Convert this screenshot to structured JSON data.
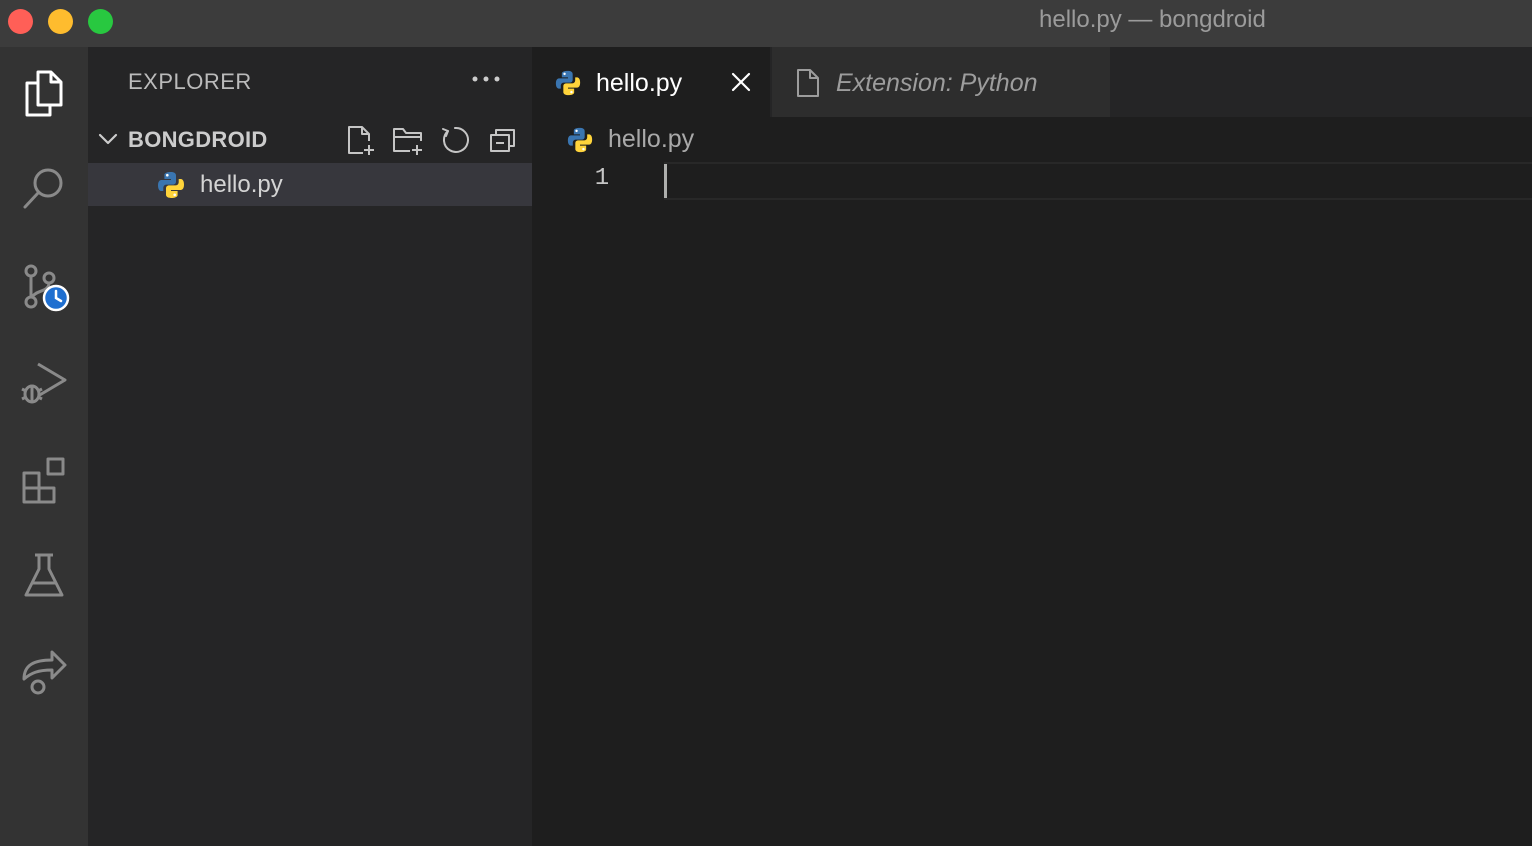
{
  "window": {
    "title": "hello.py — bongdroid",
    "controls": [
      "close",
      "minimize",
      "zoom"
    ]
  },
  "activity_bar": {
    "items": [
      {
        "icon": "files-icon",
        "active": true
      },
      {
        "icon": "search-icon",
        "active": false
      },
      {
        "icon": "source-control-icon",
        "active": false
      },
      {
        "icon": "run-debug-icon",
        "active": false
      },
      {
        "icon": "extensions-icon",
        "active": false
      },
      {
        "icon": "testing-icon",
        "active": false
      },
      {
        "icon": "remote-share-icon",
        "active": false
      }
    ]
  },
  "sidebar": {
    "header": "EXPLORER",
    "more_icon": "ellipsis-icon",
    "folder": {
      "name": "BONGDROID",
      "actions": [
        "new-file-icon",
        "new-folder-icon",
        "refresh-icon",
        "collapse-all-icon"
      ]
    },
    "files": [
      {
        "name": "hello.py",
        "icon": "python-icon",
        "selected": true
      }
    ]
  },
  "editor": {
    "tabs": [
      {
        "label": "hello.py",
        "icon": "python-icon",
        "active": true
      },
      {
        "label": "Extension: Python",
        "icon": "file-icon",
        "active": false
      }
    ],
    "breadcrumb": "hello.py",
    "lines": [
      "1"
    ]
  },
  "colors": {
    "python_blue": "#3a75b0",
    "python_yellow": "#ffd43b",
    "accent_badge": "#1f6fd0"
  }
}
